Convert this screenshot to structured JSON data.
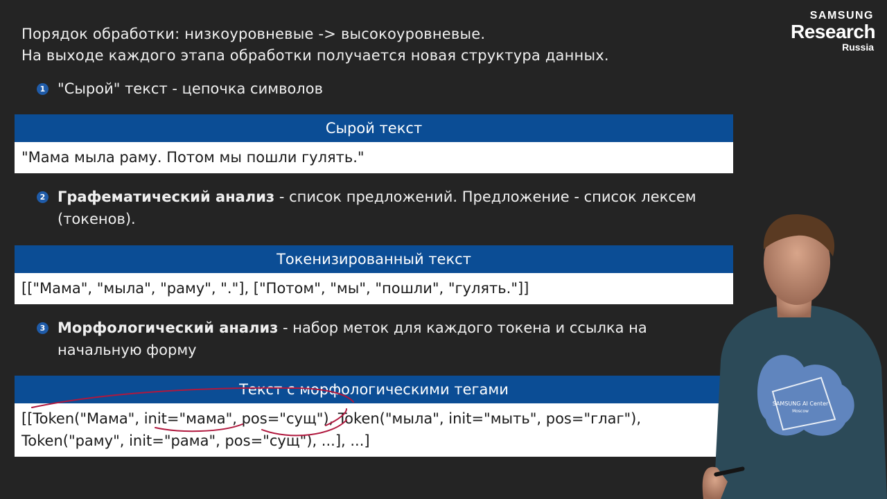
{
  "slide": {
    "intro_line1": "Порядок обработки: низкоуровневые -> высокоуровневые.",
    "intro_line2": "На выходе каждого этапа обработки получается новая структура данных."
  },
  "logo": {
    "line1": "SAMSUNG",
    "line2": "Research",
    "line3": "Russia"
  },
  "steps": [
    {
      "number": "1",
      "bold": "",
      "text": "\"Сырой\" текст - цепочка символов"
    },
    {
      "number": "2",
      "bold": "Графематический анализ",
      "text": " - список предложений. Предложение - список лексем",
      "text2": "(токенов)."
    },
    {
      "number": "3",
      "bold": "Морфологический анализ",
      "text": " - набор меток для каждого токена и ссылка на",
      "text2": "начальную форму"
    }
  ],
  "blocks": [
    {
      "title": "Сырой текст",
      "lines": [
        "\"Мама мыла раму. Потом мы пошли гулять.\""
      ]
    },
    {
      "title": "Токенизированный текст",
      "lines": [
        "[[\"Мама\", \"мыла\", \"раму\", \".\"], [\"Потом\", \"мы\", \"пошли\", \"гулять.\"]]"
      ]
    },
    {
      "title": "Текст с морфологическими тегами",
      "lines": [
        "[[Token(\"Мама\", init=\"мама\", pos=\"сущ\"), Token(\"мыла\", init=\"мыть\", pos=\"глаг\"),",
        "Token(\"раму\", init=\"рама\", pos=\"сущ\"), ...], ...]"
      ]
    }
  ],
  "shirt_print": {
    "line1": "SAMSUNG AI Center",
    "line2": "Moscow"
  },
  "colors": {
    "background": "#242424",
    "block_header": "#0b4d95",
    "bullet": "#1f5ba8",
    "annotation_ink": "#b0183e"
  }
}
